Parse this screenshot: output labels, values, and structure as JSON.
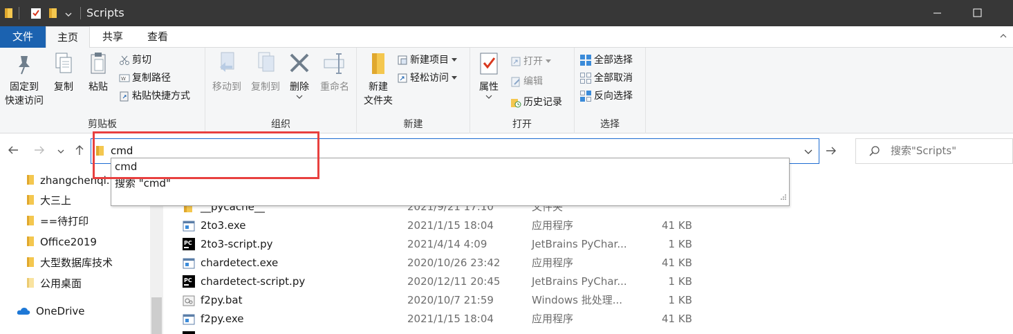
{
  "window": {
    "title": "Scripts"
  },
  "tabs": [
    {
      "label": "文件"
    },
    {
      "label": "主页"
    },
    {
      "label": "共享"
    },
    {
      "label": "查看"
    }
  ],
  "ribbon": {
    "clipboard": {
      "label": "剪贴板",
      "pin_line1": "固定到",
      "pin_line2": "快速访问",
      "copy": "复制",
      "paste": "粘贴",
      "cut": "剪切",
      "copy_path": "复制路径",
      "paste_shortcut": "粘贴快捷方式"
    },
    "organize": {
      "label": "组织",
      "move_to": "移动到",
      "copy_to": "复制到",
      "delete": "删除",
      "rename": "重命名"
    },
    "new": {
      "label": "新建",
      "new_folder_line1": "新建",
      "new_folder_line2": "文件夹",
      "new_item": "新建项目",
      "easy_access": "轻松访问"
    },
    "open": {
      "label": "打开",
      "properties": "属性",
      "open": "打开",
      "edit": "编辑",
      "history": "历史记录"
    },
    "select": {
      "label": "选择",
      "select_all": "全部选择",
      "select_none": "全部取消",
      "invert": "反向选择"
    }
  },
  "address": {
    "value": "cmd"
  },
  "search": {
    "placeholder": "搜索\"Scripts\""
  },
  "suggestions": [
    {
      "label": "cmd"
    },
    {
      "label": "搜索 \"cmd\""
    }
  ],
  "nav_items": [
    {
      "label": "zhangchenqi."
    },
    {
      "label": "大三上"
    },
    {
      "label": "==待打印"
    },
    {
      "label": "Office2019"
    },
    {
      "label": "大型数据库技术"
    },
    {
      "label": "公用桌面"
    },
    {
      "label": "OneDrive"
    }
  ],
  "files": [
    {
      "name": "__pycache__",
      "date": "2021/9/21 17:10",
      "type": "文件夹",
      "size": "",
      "icon": "folder-icon"
    },
    {
      "name": "2to3.exe",
      "date": "2021/1/15 18:04",
      "type": "应用程序",
      "size": "41 KB",
      "icon": "exe-icon"
    },
    {
      "name": "2to3-script.py",
      "date": "2021/4/14 4:09",
      "type": "JetBrains PyChar...",
      "size": "1 KB",
      "icon": "pycharm-icon"
    },
    {
      "name": "chardetect.exe",
      "date": "2020/10/26 23:42",
      "type": "应用程序",
      "size": "41 KB",
      "icon": "exe-icon"
    },
    {
      "name": "chardetect-script.py",
      "date": "2020/12/11 20:45",
      "type": "JetBrains PyChar...",
      "size": "1 KB",
      "icon": "pycharm-icon"
    },
    {
      "name": "f2py.bat",
      "date": "2020/10/7 21:59",
      "type": "Windows 批处理...",
      "size": "1 KB",
      "icon": "bat-icon"
    },
    {
      "name": "f2py.exe",
      "date": "2021/1/15 18:04",
      "type": "应用程序",
      "size": "41 KB",
      "icon": "exe-icon"
    }
  ]
}
